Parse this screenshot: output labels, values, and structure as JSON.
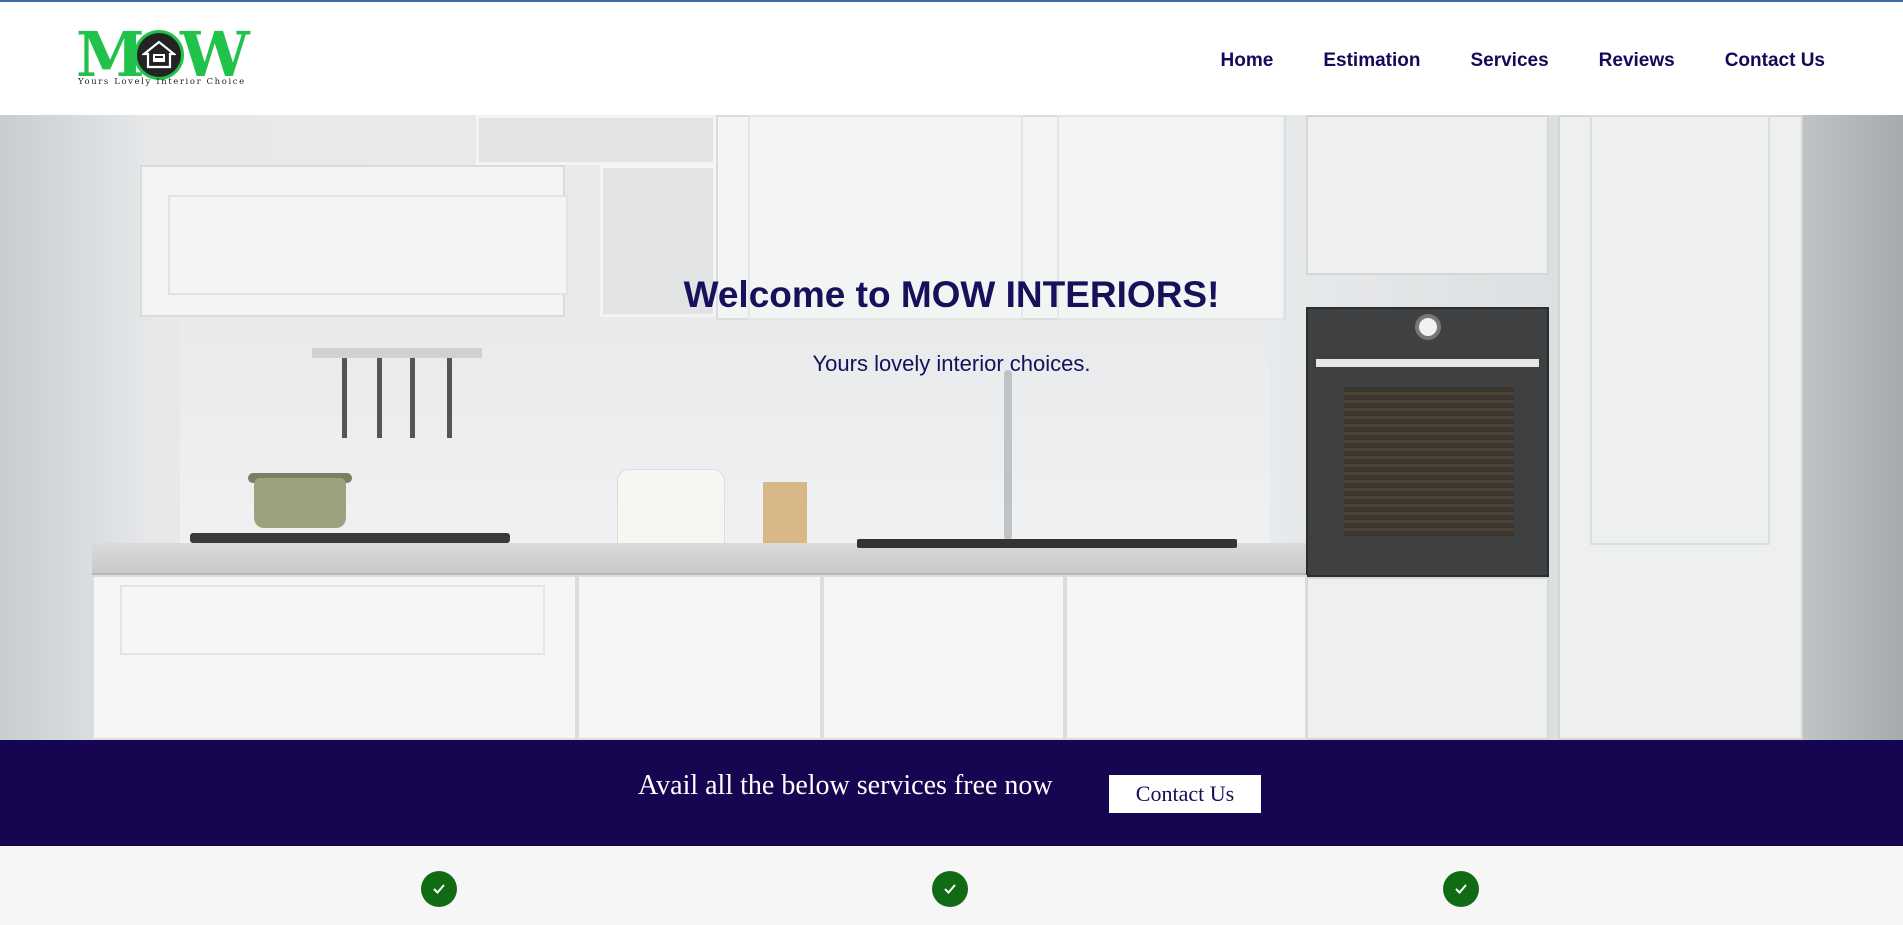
{
  "brand": {
    "logo_text_left": "M",
    "logo_text_right": "W",
    "tagline": "Yours Lovely Interior Choice",
    "accent_color": "#21c24a",
    "logo_icon": "house-icon"
  },
  "nav": {
    "items": [
      {
        "label": "Home"
      },
      {
        "label": "Estimation"
      },
      {
        "label": "Services"
      },
      {
        "label": "Reviews"
      },
      {
        "label": "Contact Us"
      }
    ],
    "text_color": "#140a5a"
  },
  "hero": {
    "title": "Welcome to MOW INTERIORS!",
    "subtitle": "Yours lovely interior choices.",
    "text_color": "#17105a",
    "background_image": "white-kitchen-photo"
  },
  "cta": {
    "text": "Avail all the below services free now",
    "button_label": "Contact Us",
    "background_color": "#160550"
  },
  "features": {
    "icons": [
      "check-icon",
      "check-icon",
      "check-icon"
    ],
    "icon_color": "#116b14"
  }
}
